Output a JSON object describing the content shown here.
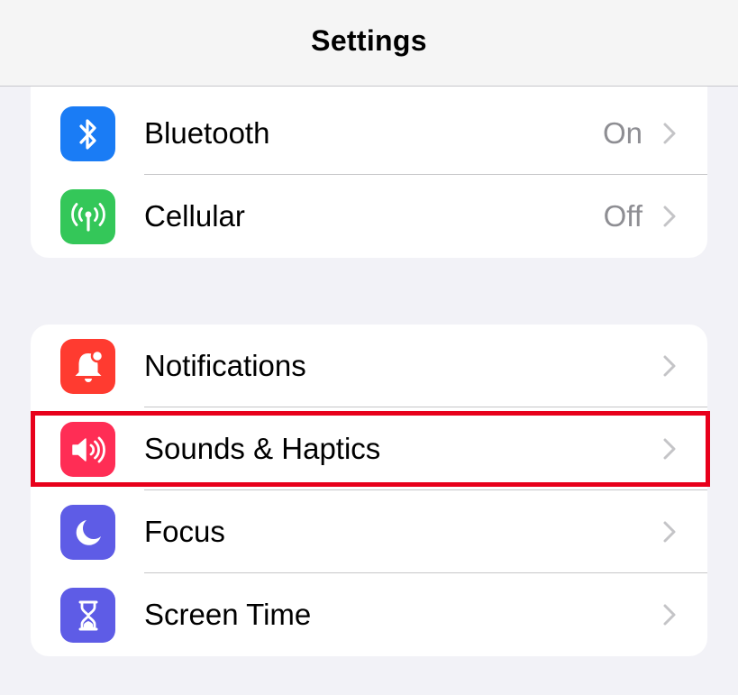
{
  "nav": {
    "title": "Settings"
  },
  "colors": {
    "bluetooth": "#1a7cf5",
    "cellular": "#34c759",
    "notifications": "#ff3b30",
    "sounds": "#ff2d55",
    "focus": "#5e5ce6",
    "screen_time": "#5e5ce6",
    "highlight": "#e8001b"
  },
  "groups": [
    {
      "rows": [
        {
          "label": "Bluetooth",
          "value": "On",
          "icon": "bluetooth-icon"
        },
        {
          "label": "Cellular",
          "value": "Off",
          "icon": "cellular-antenna-icon"
        }
      ]
    },
    {
      "rows": [
        {
          "label": "Notifications",
          "value": "",
          "icon": "bell-icon"
        },
        {
          "label": "Sounds & Haptics",
          "value": "",
          "icon": "speaker-icon"
        },
        {
          "label": "Focus",
          "value": "",
          "icon": "moon-icon"
        },
        {
          "label": "Screen Time",
          "value": "",
          "icon": "hourglass-icon"
        }
      ]
    }
  ]
}
